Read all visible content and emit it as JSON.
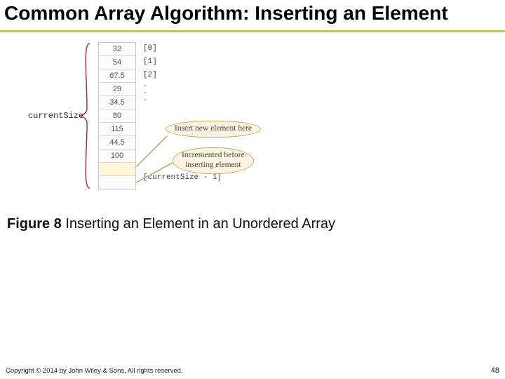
{
  "title": "Common Array Algorithm: Inserting an Element",
  "figure": {
    "currentSizeLabel": "currentSize",
    "cells": [
      "32",
      "54",
      "67.5",
      "29",
      "34.5",
      "80",
      "115",
      "44.5",
      "100",
      "",
      ""
    ],
    "highlight_index": 9,
    "idx": {
      "top": [
        "[0]",
        "[1]",
        "[2]"
      ],
      "bottom": "[currentSize - 1]"
    },
    "callouts": {
      "insert": "Insert new element here",
      "increment_l1": "Incremented before",
      "increment_l2": "inserting element"
    }
  },
  "caption": {
    "num": "Figure 8",
    "text": " Inserting an Element in an Unordered Array"
  },
  "footer": {
    "left": "Copyright © 2014 by John Wiley & Sons. All rights reserved.",
    "right": "48"
  }
}
